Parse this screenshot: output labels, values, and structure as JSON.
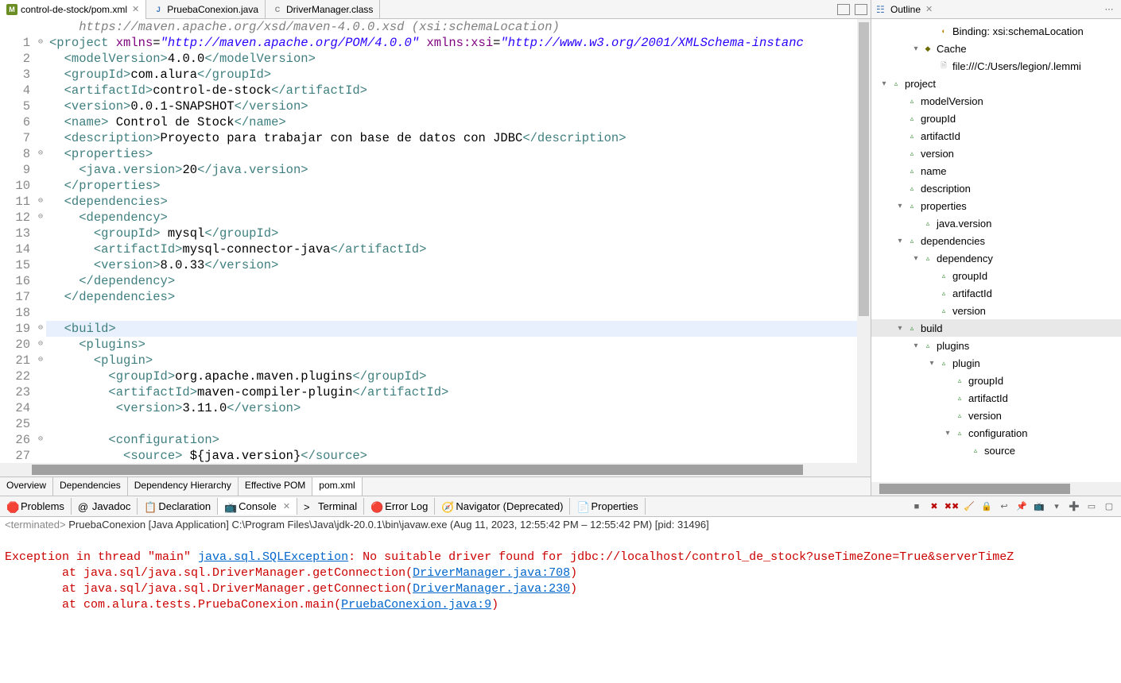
{
  "editor": {
    "tabs": [
      {
        "icon": "m",
        "label": "control-de-stock/pom.xml",
        "active": true
      },
      {
        "icon": "j",
        "label": "PruebaConexion.java",
        "active": false
      },
      {
        "icon": "c",
        "label": "DriverManager.class",
        "active": false
      }
    ],
    "lines": [
      {
        "n": "",
        "fold": "",
        "raw_schema": "    https://maven.apache.org/xsd/maven-4.0.0.xsd (xsi:schemaLocation)"
      },
      {
        "n": "1",
        "fold": "⊖",
        "html": "<span class='c-tag'>&lt;project</span> <span class='c-attr'>xmlns</span>=<span class='c-attr-v'>\"http://maven.apache.org/POM/4.0.0\"</span> <span class='c-attr'>xmlns:xsi</span>=<span class='c-attr-v'>\"http://www.w3.org/2001/XMLSchema-instanc</span>"
      },
      {
        "n": "2",
        "fold": "",
        "html": "  <span class='c-tag'>&lt;modelVersion&gt;</span>4.0.0<span class='c-tag'>&lt;/modelVersion&gt;</span>"
      },
      {
        "n": "3",
        "fold": "",
        "html": "  <span class='c-tag'>&lt;groupId&gt;</span>com.alura<span class='c-tag'>&lt;/groupId&gt;</span>"
      },
      {
        "n": "4",
        "fold": "",
        "html": "  <span class='c-tag'>&lt;artifactId&gt;</span>control-de-stock<span class='c-tag'>&lt;/artifactId&gt;</span>"
      },
      {
        "n": "5",
        "fold": "",
        "html": "  <span class='c-tag'>&lt;version&gt;</span>0.0.1-SNAPSHOT<span class='c-tag'>&lt;/version&gt;</span>"
      },
      {
        "n": "6",
        "fold": "",
        "html": "  <span class='c-tag'>&lt;name&gt;</span> Control de Stock<span class='c-tag'>&lt;/name&gt;</span>"
      },
      {
        "n": "7",
        "fold": "",
        "html": "  <span class='c-tag'>&lt;description&gt;</span>Proyecto para trabajar con base de datos con JDBC<span class='c-tag'>&lt;/description&gt;</span>"
      },
      {
        "n": "8",
        "fold": "⊖",
        "html": "  <span class='c-tag'>&lt;properties&gt;</span>"
      },
      {
        "n": "9",
        "fold": "",
        "html": "    <span class='c-tag'>&lt;java.version&gt;</span>20<span class='c-tag'>&lt;/java.version&gt;</span>"
      },
      {
        "n": "10",
        "fold": "",
        "html": "  <span class='c-tag'>&lt;/properties&gt;</span>"
      },
      {
        "n": "11",
        "fold": "⊖",
        "html": "  <span class='c-tag'>&lt;dependencies&gt;</span>"
      },
      {
        "n": "12",
        "fold": "⊖",
        "html": "    <span class='c-tag'>&lt;dependency&gt;</span>"
      },
      {
        "n": "13",
        "fold": "",
        "html": "      <span class='c-tag'>&lt;groupId&gt;</span> mysql<span class='c-tag'>&lt;/groupId&gt;</span>"
      },
      {
        "n": "14",
        "fold": "",
        "html": "      <span class='c-tag'>&lt;artifactId&gt;</span>mysql-connector-java<span class='c-tag'>&lt;/artifactId&gt;</span>"
      },
      {
        "n": "15",
        "fold": "",
        "html": "      <span class='c-tag'>&lt;version&gt;</span>8.0.33<span class='c-tag'>&lt;/version&gt;</span>"
      },
      {
        "n": "16",
        "fold": "",
        "html": "    <span class='c-tag'>&lt;/dependency&gt;</span>"
      },
      {
        "n": "17",
        "fold": "",
        "html": "  <span class='c-tag'>&lt;/dependencies&gt;</span>"
      },
      {
        "n": "18",
        "fold": "",
        "html": "  "
      },
      {
        "n": "19",
        "fold": "⊖",
        "hl": true,
        "html": "  <span class='c-tag'>&lt;build&gt;</span>"
      },
      {
        "n": "20",
        "fold": "⊖",
        "html": "    <span class='c-tag'>&lt;plugins&gt;</span>"
      },
      {
        "n": "21",
        "fold": "⊖",
        "html": "      <span class='c-tag'>&lt;plugin&gt;</span>"
      },
      {
        "n": "22",
        "fold": "",
        "html": "        <span class='c-tag'>&lt;groupId&gt;</span>org.apache.maven.plugins<span class='c-tag'>&lt;/groupId&gt;</span>"
      },
      {
        "n": "23",
        "fold": "",
        "html": "        <span class='c-tag'>&lt;artifactId&gt;</span>maven-compiler-plugin<span class='c-tag'>&lt;/artifactId&gt;</span>"
      },
      {
        "n": "24",
        "fold": "",
        "html": "         <span class='c-tag'>&lt;version&gt;</span>3.11.0<span class='c-tag'>&lt;/version&gt;</span>"
      },
      {
        "n": "25",
        "fold": "",
        "html": "        "
      },
      {
        "n": "26",
        "fold": "⊖",
        "html": "        <span class='c-tag'>&lt;configuration&gt;</span>"
      },
      {
        "n": "27",
        "fold": "",
        "html": "          <span class='c-tag'>&lt;source&gt;</span> ${java.version}<span class='c-tag'>&lt;/source&gt;</span>"
      }
    ],
    "bottom_tabs": [
      {
        "label": "Overview"
      },
      {
        "label": "Dependencies"
      },
      {
        "label": "Dependency Hierarchy"
      },
      {
        "label": "Effective POM"
      },
      {
        "label": "pom.xml",
        "active": true
      }
    ]
  },
  "outline": {
    "title": "Outline",
    "rows": [
      {
        "indent": 3,
        "exp": "",
        "ico": "attr",
        "label": "Binding: xsi:schemaLocation"
      },
      {
        "indent": 2,
        "exp": "▾",
        "ico": "root",
        "label": "Cache"
      },
      {
        "indent": 3,
        "exp": "",
        "ico": "file",
        "label": "file:///C:/Users/legion/.lemmi"
      },
      {
        "indent": 0,
        "exp": "▾",
        "ico": "elem",
        "label": "project"
      },
      {
        "indent": 1,
        "exp": "",
        "ico": "elem",
        "label": "modelVersion"
      },
      {
        "indent": 1,
        "exp": "",
        "ico": "elem",
        "label": "groupId"
      },
      {
        "indent": 1,
        "exp": "",
        "ico": "elem",
        "label": "artifactId"
      },
      {
        "indent": 1,
        "exp": "",
        "ico": "elem",
        "label": "version"
      },
      {
        "indent": 1,
        "exp": "",
        "ico": "elem",
        "label": "name"
      },
      {
        "indent": 1,
        "exp": "",
        "ico": "elem",
        "label": "description"
      },
      {
        "indent": 1,
        "exp": "▾",
        "ico": "elem",
        "label": "properties"
      },
      {
        "indent": 2,
        "exp": "",
        "ico": "elem",
        "label": "java.version"
      },
      {
        "indent": 1,
        "exp": "▾",
        "ico": "elem",
        "label": "dependencies"
      },
      {
        "indent": 2,
        "exp": "▾",
        "ico": "elem",
        "label": "dependency"
      },
      {
        "indent": 3,
        "exp": "",
        "ico": "elem",
        "label": "groupId"
      },
      {
        "indent": 3,
        "exp": "",
        "ico": "elem",
        "label": "artifactId"
      },
      {
        "indent": 3,
        "exp": "",
        "ico": "elem",
        "label": "version"
      },
      {
        "indent": 1,
        "exp": "▾",
        "ico": "elem",
        "label": "build",
        "sel": true
      },
      {
        "indent": 2,
        "exp": "▾",
        "ico": "elem",
        "label": "plugins"
      },
      {
        "indent": 3,
        "exp": "▾",
        "ico": "elem",
        "label": "plugin"
      },
      {
        "indent": 4,
        "exp": "",
        "ico": "elem",
        "label": "groupId"
      },
      {
        "indent": 4,
        "exp": "",
        "ico": "elem",
        "label": "artifactId"
      },
      {
        "indent": 4,
        "exp": "",
        "ico": "elem",
        "label": "version"
      },
      {
        "indent": 4,
        "exp": "▾",
        "ico": "elem",
        "label": "configuration"
      },
      {
        "indent": 5,
        "exp": "",
        "ico": "elem",
        "label": "source"
      }
    ]
  },
  "views": {
    "tabs": [
      {
        "ico": "🛑",
        "label": "Problems"
      },
      {
        "ico": "@",
        "label": "Javadoc"
      },
      {
        "ico": "📋",
        "label": "Declaration"
      },
      {
        "ico": "📺",
        "label": "Console",
        "active": true
      },
      {
        "ico": ">",
        "label": "Terminal"
      },
      {
        "ico": "🔴",
        "label": "Error Log"
      },
      {
        "ico": "🧭",
        "label": "Navigator (Deprecated)"
      },
      {
        "ico": "📄",
        "label": "Properties"
      }
    ],
    "status_prefix": "<terminated> ",
    "status_main": "PruebaConexion [Java Application] C:\\Program Files\\Java\\jdk-20.0.1\\bin\\javaw.exe  (Aug 11, 2023, 12:55:42 PM – 12:55:42 PM) [pid: 31496]",
    "console": {
      "l1a": "Exception in thread \"main\" ",
      "l1b": "java.sql.SQLException",
      "l1c": ": No suitable driver found for jdbc://localhost/control_de_stock?useTimeZone=True&serverTimeZ",
      "l2a": "        at java.sql/java.sql.DriverManager.getConnection(",
      "l2b": "DriverManager.java:708",
      "l2c": ")",
      "l3a": "        at java.sql/java.sql.DriverManager.getConnection(",
      "l3b": "DriverManager.java:230",
      "l3c": ")",
      "l4a": "        at com.alura.tests.PruebaConexion.main(",
      "l4b": "PruebaConexion.java:9",
      "l4c": ")"
    }
  }
}
